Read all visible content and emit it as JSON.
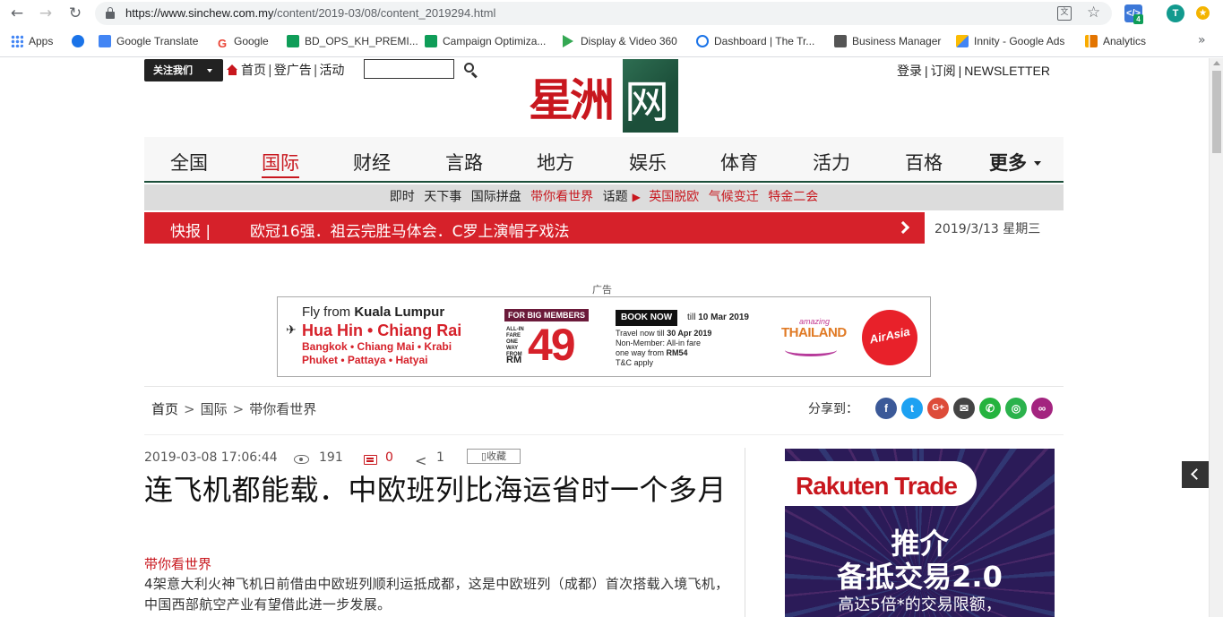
{
  "browser": {
    "url_host": "https://www.sinchew.com.my",
    "url_path": "/content/2019-03/08/content_2019294.html",
    "profile_initial": "T",
    "ext_badge": "4",
    "bookmarks": [
      {
        "label": "Apps",
        "color": "#e94235"
      },
      {
        "label": "",
        "color": "#1a73e8"
      },
      {
        "label": "Google Translate",
        "color": "#4285f4"
      },
      {
        "label": "Google",
        "color": "#ea4335"
      },
      {
        "label": "BD_OPS_KH_PREMI...",
        "color": "#0f9d58"
      },
      {
        "label": "Campaign Optimiza...",
        "color": "#0f9d58"
      },
      {
        "label": "Display & Video 360",
        "color": "#34a853"
      },
      {
        "label": "Dashboard | The Tr...",
        "color": "#1a73e8"
      },
      {
        "label": "Business Manager",
        "color": "#555555"
      },
      {
        "label": "Innity - Google Ads",
        "color": "#fbbc04"
      },
      {
        "label": "Analytics",
        "color": "#f9ab00"
      }
    ]
  },
  "header": {
    "follow_label": "关注我们",
    "home_label": "首页",
    "ad_link": "登广告",
    "events_link": "活动",
    "search_placeholder": "",
    "logo_text": "星洲",
    "logo_box_char": "网",
    "login": "登录",
    "subscribe": "订阅",
    "newsletter": "NEWSLETTER"
  },
  "mainnav": {
    "items": [
      "全国",
      "国际",
      "财经",
      "言路",
      "地方",
      "娱乐",
      "体育",
      "活力",
      "百格"
    ],
    "active": "国际",
    "more": "更多"
  },
  "subnav": {
    "items": [
      "即时",
      "天下事",
      "国际拼盘",
      "带你看世界"
    ],
    "topic_label": "话题",
    "topics": [
      "英国脱欧",
      "气候变迁",
      "特金二会"
    ]
  },
  "breaking": {
    "label": "快报 |",
    "text": "欧冠16强．祖云完胜马体会．C罗上演帽子戏法",
    "date": "2019/3/13 星期三"
  },
  "ad": {
    "label": "广告",
    "fly_from": "Fly from",
    "fly_city": "Kuala Lumpur",
    "dest_main": "Hua Hin • Chiang Rai",
    "dest_line2": "Bangkok • Chiang Mai • Krabi",
    "dest_line3": "Phuket • Pattaya • Hatyai",
    "big_members": "FOR BIG MEMBERS",
    "all_in": "ALL-IN FARE ONE WAY FROM",
    "currency": "RM",
    "price": "49",
    "book_now": "BOOK NOW",
    "till_prefix": "till",
    "till_date": "10 Mar 2019",
    "travel_prefix": "Travel now till",
    "travel_date": "30 Apr 2019",
    "nonmember": "Non-Member: All-in fare",
    "oneway_prefix": "one way from",
    "oneway_price": "RM54",
    "tc": "T&C apply",
    "amazing": "amazing",
    "thailand": "THAILAND",
    "airasia": "AirAsia"
  },
  "breadcrumb": {
    "home": "首页",
    "section": "国际",
    "column": "带你看世界"
  },
  "share": {
    "label": "分享到：",
    "buttons": [
      {
        "name": "facebook",
        "glyph": "f",
        "color": "#3b5998"
      },
      {
        "name": "twitter",
        "glyph": "t",
        "color": "#1da1f2"
      },
      {
        "name": "googleplus",
        "glyph": "G+",
        "color": "#dd4b39"
      },
      {
        "name": "email",
        "glyph": "✉",
        "color": "#444444"
      },
      {
        "name": "whatsapp",
        "glyph": "✆",
        "color": "#25b33e"
      },
      {
        "name": "wechat",
        "glyph": "◎",
        "color": "#2bb24c"
      },
      {
        "name": "link",
        "glyph": "∞",
        "color": "#a3247f"
      }
    ]
  },
  "article": {
    "datetime": "2019-03-08 17:06:44",
    "views": "191",
    "comments": "0",
    "shares": "1",
    "favorite": "收藏",
    "headline": "连飞机都能载．中欧班列比海运省时一个多月",
    "column_tag": "带你看世界",
    "summary": "4架意大利火神飞机日前借由中欧班列顺利运抵成都，这是中欧班列（成都）首次搭载入境飞机，中国西部航空产业有望借此进一步发展。"
  },
  "side_ad": {
    "brand": "Rakuten Trade",
    "title1": "推介",
    "title2": "备抵交易2.0",
    "sub": "高达5倍*的交易限额，"
  }
}
